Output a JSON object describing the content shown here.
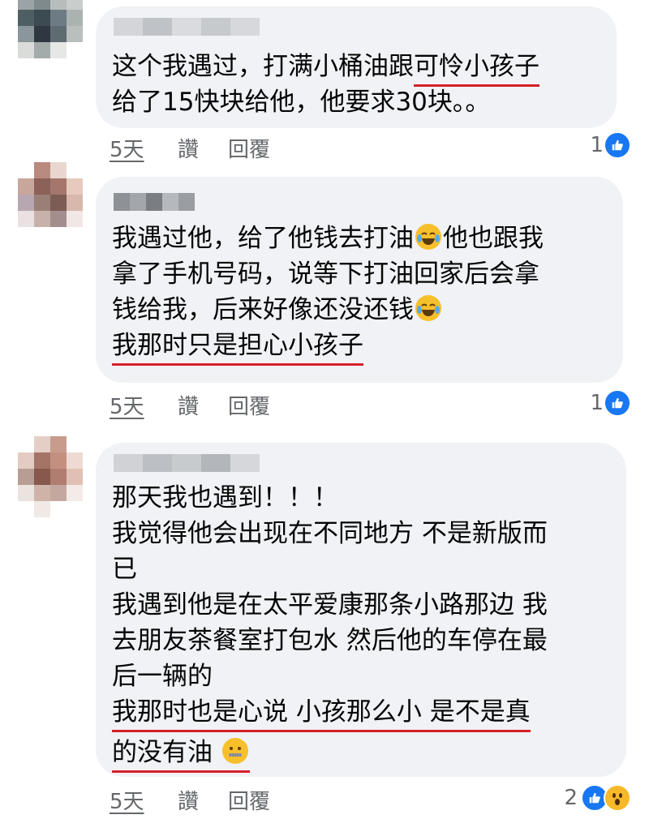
{
  "comments": [
    {
      "lines": [
        {
          "text": "这个我遇过，打满小桶油跟",
          "underlined": false,
          "tail": "可怜小孩子",
          "tail_underlined": true
        },
        {
          "text": "给了15快块给他，他要求30块。。",
          "underlined": false
        }
      ],
      "time": "5天",
      "like_label": "讚",
      "reply_label": "回覆",
      "reaction_count": "1",
      "reactions": [
        "like-icon"
      ]
    },
    {
      "lines": [
        {
          "text": "我遇过他，给了他钱去打油",
          "emoji_after": "joy-emoji",
          "tail": "他也跟我"
        },
        {
          "text": "拿了手机号码，说等下打油回家后会拿"
        },
        {
          "text": "钱给我，后来好像还没还钱",
          "emoji_after": "joy-emoji"
        },
        {
          "text": "我那时只是担心小孩子",
          "underlined": true
        }
      ],
      "time": "5天",
      "like_label": "讚",
      "reply_label": "回覆",
      "reaction_count": "1",
      "reactions": [
        "like-icon"
      ]
    },
    {
      "lines": [
        {
          "text": "那天我也遇到！！！"
        },
        {
          "text": "我觉得他会出现在不同地方 不是新版而"
        },
        {
          "text": "已"
        },
        {
          "text": "我遇到他是在太平爱康那条小路那边 我"
        },
        {
          "text": "去朋友茶餐室打包水 然后他的车停在最"
        },
        {
          "text": "后一辆的"
        },
        {
          "text": "我那时也是心说 小孩那么小 是不是真",
          "underlined": true
        },
        {
          "text": "的没有油",
          "underlined": true,
          "emoji_after": "zipper-mouth-emoji"
        }
      ],
      "time": "5天",
      "like_label": "讚",
      "reply_label": "回覆",
      "reaction_count": "2",
      "reactions": [
        "like-icon",
        "wow-icon"
      ]
    }
  ],
  "colors": {
    "bubble": "#f0f2f5",
    "underline": "#d4202a",
    "like_blue": "#1877f2",
    "secondary_text": "#65676b"
  }
}
